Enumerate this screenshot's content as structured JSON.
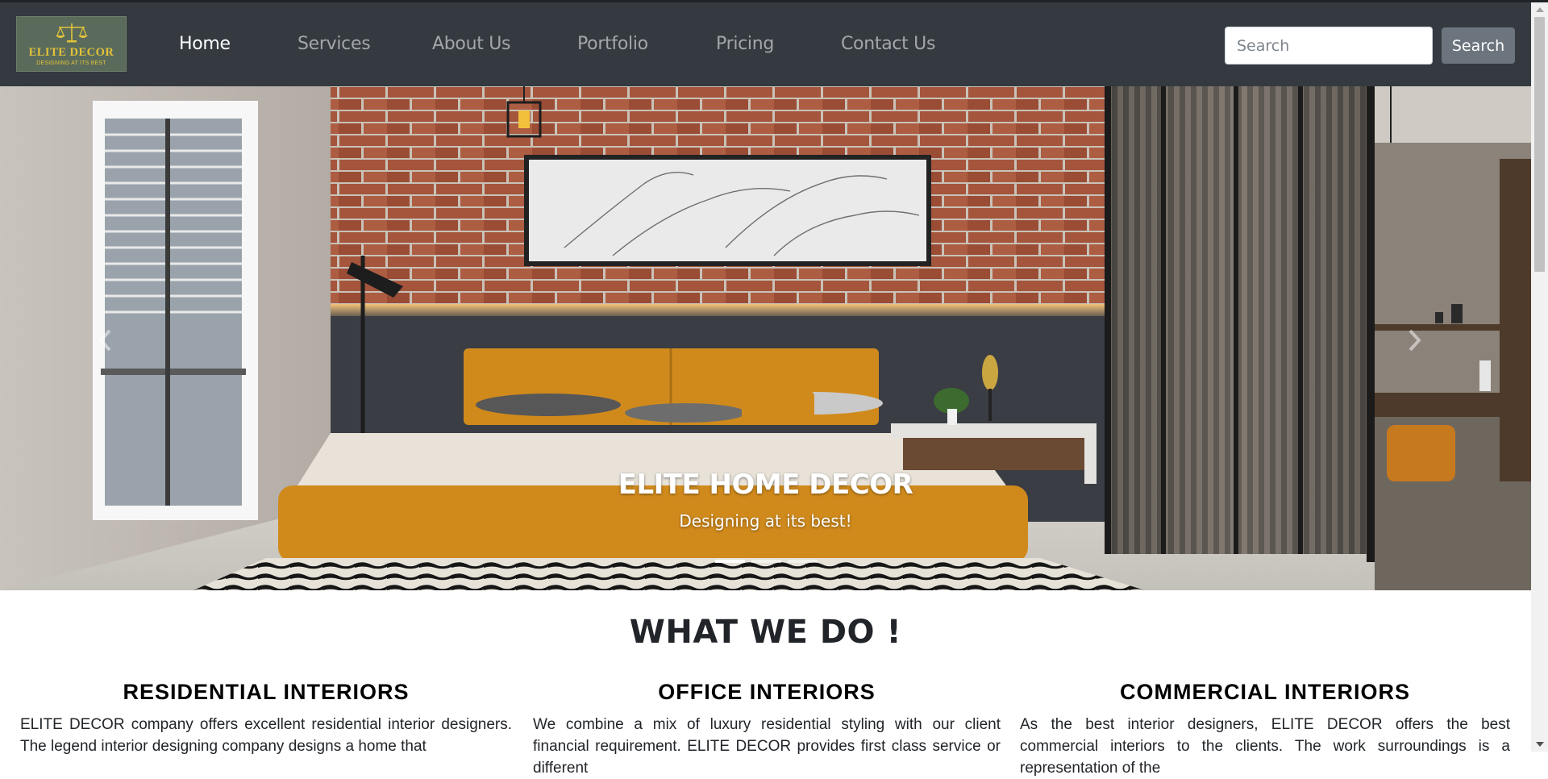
{
  "brand": {
    "name": "ELITE DECOR",
    "tagline": "DESIGNING AT ITS BEST"
  },
  "nav": {
    "links": [
      "Home",
      "Services",
      "About Us",
      "Portfolio",
      "Pricing",
      "Contact Us"
    ],
    "active": "Home"
  },
  "search": {
    "placeholder": "Search",
    "value": "",
    "button_label": "Search"
  },
  "hero": {
    "title": "ELITE HOME DECOR",
    "subtitle": "Designing at its best!",
    "slide_count": 3,
    "active_slide": 1
  },
  "section": {
    "title": "WHAT WE DO !",
    "columns": [
      {
        "title": "RESIDENTIAL INTERIORS",
        "text": "ELITE DECOR company offers excellent residential interior designers. The legend interior designing company designs a home that"
      },
      {
        "title": "OFFICE INTERIORS",
        "text": "We combine a mix of luxury residential styling with our client financial requirement. ELITE DECOR provides first class service or different"
      },
      {
        "title": "COMMERCIAL INTERIORS",
        "text": "As the best interior designers, ELITE DECOR offers the best commercial interiors to the clients. The work surroundings is a representation of the"
      }
    ]
  },
  "colors": {
    "navbar": "#343a40",
    "logo_gold": "#e3c33a",
    "search_button": "#6c757d",
    "bed_orange": "#d08a1c",
    "brick": "#a4553c"
  }
}
